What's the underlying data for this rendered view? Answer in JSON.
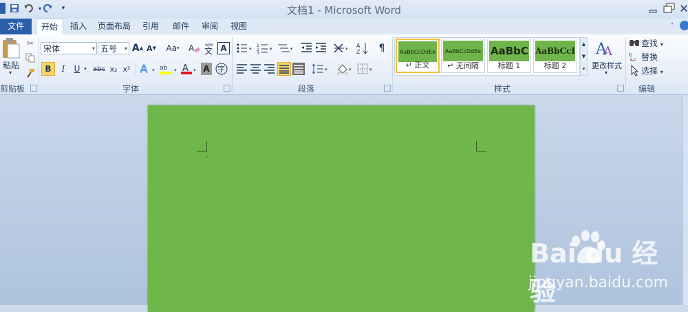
{
  "window": {
    "title": "文档1 - Microsoft Word"
  },
  "tabs": [
    {
      "label": "文件"
    },
    {
      "label": "开始"
    },
    {
      "label": "插入"
    },
    {
      "label": "页面布局"
    },
    {
      "label": "引用"
    },
    {
      "label": "邮件"
    },
    {
      "label": "审阅"
    },
    {
      "label": "视图"
    }
  ],
  "clipboard": {
    "paste_label": "粘贴",
    "group_label": "剪贴板"
  },
  "font": {
    "family": "宋体",
    "size": "五号",
    "group_label": "字体",
    "format_buttons": [
      "B",
      "I",
      "U",
      "abc",
      "x₂",
      "x²"
    ],
    "grow_label": "A",
    "shrink_label": "A",
    "case_label": "Aa",
    "phonetic_label": "wén",
    "char_border_label": "A",
    "highlight_color": "#ffff00",
    "font_color": "#e81123"
  },
  "paragraph": {
    "group_label": "段落"
  },
  "styles": {
    "group_label": "样式",
    "items": [
      {
        "preview": "AaBbCcDdEe",
        "name": "↵ 正文"
      },
      {
        "preview": "AaBbCcDdEe",
        "name": "↵ 无间隔"
      },
      {
        "preview": "AaBbC(",
        "name": "标题 1"
      },
      {
        "preview": "AaBbCcI",
        "name": "标题 2"
      }
    ],
    "change_styles_label": "更改样式"
  },
  "editing": {
    "group_label": "编辑",
    "find_label": "查找",
    "replace_label": "替换",
    "select_label": "选择"
  },
  "document": {
    "page_color": "#6fb74a"
  },
  "watermark": {
    "brand": "Bai du 经验",
    "url": "jingyan.baidu.com"
  }
}
